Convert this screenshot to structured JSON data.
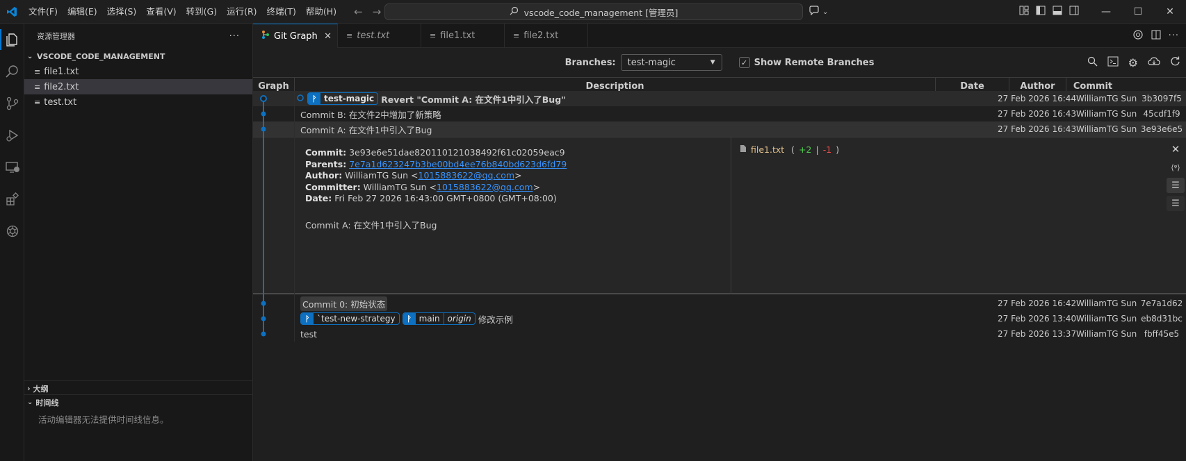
{
  "menu": [
    "文件(F)",
    "编辑(E)",
    "选择(S)",
    "查看(V)",
    "转到(G)",
    "运行(R)",
    "终端(T)",
    "帮助(H)"
  ],
  "command_center": "vscode_code_management [管理员]",
  "sidebar": {
    "title": "资源管理器",
    "folder": "VSCODE_CODE_MANAGEMENT",
    "files": [
      "file1.txt",
      "file2.txt",
      "test.txt"
    ],
    "outline": "大纲",
    "timeline": "时间线",
    "timeline_note": "活动编辑器无法提供时间线信息。"
  },
  "tabs": [
    {
      "label": "Git Graph"
    },
    {
      "label": "test.txt"
    },
    {
      "label": "file1.txt"
    },
    {
      "label": "file2.txt"
    }
  ],
  "controls": {
    "branches_label": "Branches:",
    "branch_value": "test-magic",
    "remote_label": "Show Remote Branches"
  },
  "columns": {
    "graph": "Graph",
    "description": "Description",
    "date": "Date",
    "author": "Author",
    "commit": "Commit"
  },
  "commits": [
    {
      "description": "Revert \"Commit A: 在文件1中引入了Bug\"",
      "date": "27 Feb 2026 16:44",
      "author": "WilliamTG Sun",
      "hash": "3b3097f5"
    },
    {
      "description": "Commit B: 在文件2中增加了新策略",
      "date": "27 Feb 2026 16:43",
      "author": "WilliamTG Sun",
      "hash": "45cdf1f9"
    },
    {
      "description": "Commit A: 在文件1中引入了Bug",
      "date": "27 Feb 2026 16:43",
      "author": "WilliamTG Sun",
      "hash": "3e93e6e5"
    },
    {
      "description": "Commit 0: 初始状态",
      "date": "27 Feb 2026 16:42",
      "author": "WilliamTG Sun",
      "hash": "7e7a1d62"
    },
    {
      "description": "修改示例",
      "date": "27 Feb 2026 13:40",
      "author": "WilliamTG Sun",
      "hash": "eb8d31bc"
    },
    {
      "description": "test",
      "date": "27 Feb 2026 13:37",
      "author": "WilliamTG Sun",
      "hash": "fbff45e5"
    }
  ],
  "refs": {
    "head_branch": "test-magic",
    "strategy_branch": "`test-new-strategy",
    "main_branch": "main",
    "origin": "origin"
  },
  "details": {
    "commit_label": "Commit:",
    "commit_value": "3e93e6e51dae820110121038492f61c02059eac9",
    "parents_label": "Parents:",
    "parents_value": "7e7a1d623247b3be00bd4ee76b840bd623d6fd79",
    "author_label": "Author:",
    "author_name": "WilliamTG Sun <",
    "author_email": "1015883622@qq.com",
    "author_end": ">",
    "committer_label": "Committer:",
    "committer_name": "WilliamTG Sun <",
    "committer_email": "1015883622@qq.com",
    "committer_end": ">",
    "date_label": "Date:",
    "date_value": "Fri Feb 27 2026 16:43:00 GMT+0800 (GMT+08:00)",
    "message": "Commit A: 在文件1中引入了Bug",
    "file": "file1.txt",
    "diff_open": "(",
    "additions": "+2",
    "sep": "|",
    "deletions": "-1",
    "diff_close": ")"
  },
  "colors": {
    "accent": "#0078d4",
    "graph": "#0e70c0",
    "add": "#4ec94e",
    "del": "#f14c4c",
    "file": "#e2c08d"
  }
}
